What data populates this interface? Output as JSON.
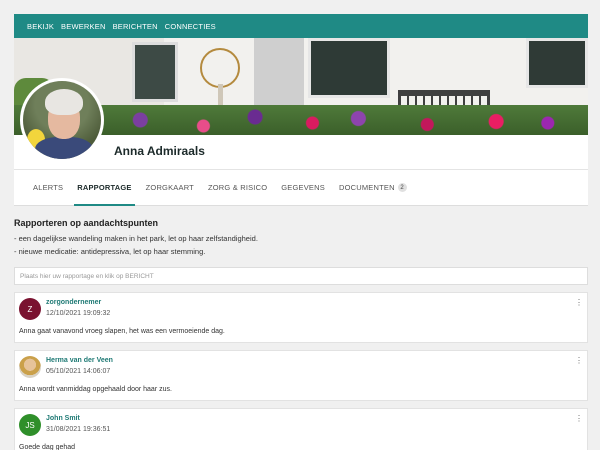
{
  "topnav": {
    "items": [
      "BEKIJK",
      "BEWERKEN",
      "BERICHTEN",
      "CONNECTIES"
    ]
  },
  "profile": {
    "name": "Anna Admiraals"
  },
  "tabs": [
    {
      "label": "ALERTS",
      "active": false
    },
    {
      "label": "RAPPORTAGE",
      "active": true
    },
    {
      "label": "ZORGKAART",
      "active": false
    },
    {
      "label": "ZORG & RISICO",
      "active": false
    },
    {
      "label": "GEGEVENS",
      "active": false
    },
    {
      "label": "DOCUMENTEN",
      "active": false,
      "badge": "2"
    }
  ],
  "attention": {
    "title": "Rapporteren op aandachtspunten",
    "lines": [
      "- een dagelijkse wandeling maken in het park, let op haar zelfstandigheid.",
      "- nieuwe medicatie: antidepressiva, let op haar stemming."
    ]
  },
  "composer": {
    "placeholder": "Plaats hier uw rapportage en klik op BERICHT"
  },
  "posts": [
    {
      "initials": "Z",
      "avatar_color": "#7a1230",
      "author": "zorgondernemer",
      "date": "12/10/2021 19:09:32",
      "text": "Anna gaat vanavond vroeg slapen, het was een vermoeiende dag."
    },
    {
      "initials": "",
      "avatar_color": "photo",
      "author": "Herma van der Veen",
      "date": "05/10/2021 14:06:07",
      "text": "Anna wordt vanmiddag opgehaald door haar zus."
    },
    {
      "initials": "JS",
      "avatar_color": "#2f8f2a",
      "author": "John Smit",
      "date": "31/08/2021 19:36:51",
      "text": "Goede dag gehad"
    }
  ],
  "icons": {
    "post_menu": "more-vert-icon"
  }
}
